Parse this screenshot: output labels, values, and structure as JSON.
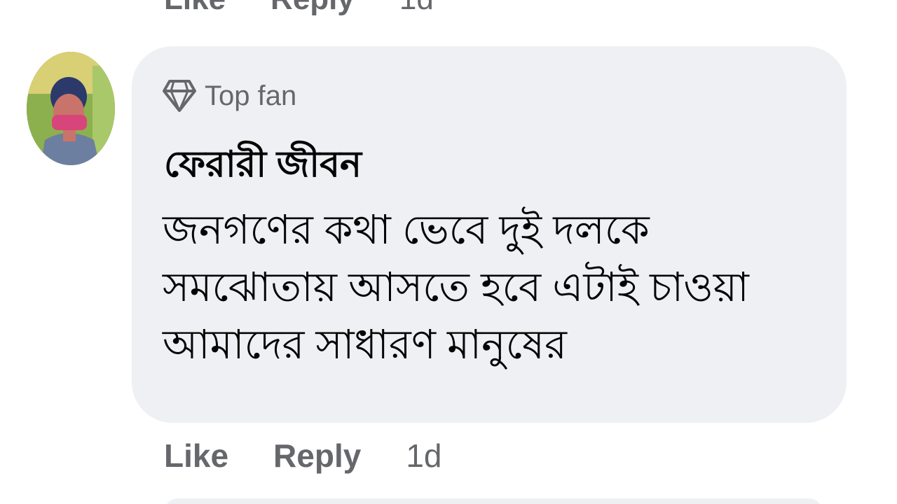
{
  "previous_comment": {
    "actions": {
      "like": "Like",
      "reply": "Reply",
      "time": "1d"
    }
  },
  "comment": {
    "avatar_icon": "user-avatar",
    "badge": {
      "icon": "diamond-icon",
      "label": "Top fan"
    },
    "author": "ফেরারী জীবন",
    "text_lines": [
      "জনগণের কথা ভেবে দুই দলকে",
      "সমঝোতায় আসতে হবে এটাই চাওয়া",
      "আমাদের সাধারণ মানুষের"
    ],
    "actions": {
      "like": "Like",
      "reply": "Reply",
      "time": "1d"
    }
  },
  "colors": {
    "bubble_bg": "#eff0f4",
    "secondary_text": "#65676b",
    "primary_text": "#050505"
  }
}
